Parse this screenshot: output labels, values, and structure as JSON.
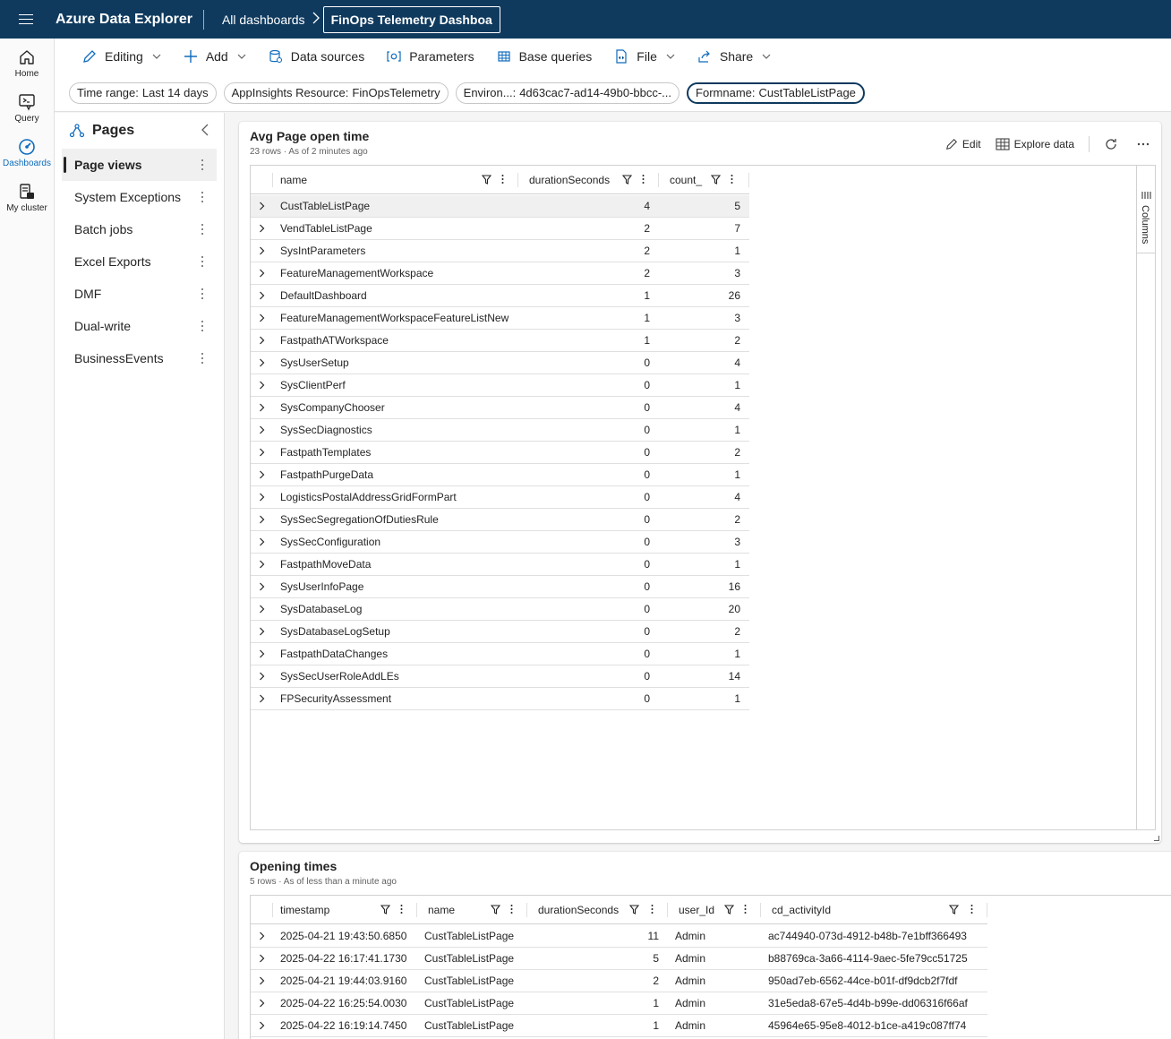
{
  "topbar": {
    "app_title": "Azure Data Explorer",
    "breadcrumb_root": "All dashboards",
    "breadcrumb_current": "FinOps Telemetry Dashboa"
  },
  "rail": {
    "home": "Home",
    "query": "Query",
    "dashboards": "Dashboards",
    "my_cluster": "My cluster"
  },
  "toolbar": {
    "editing": "Editing",
    "add": "Add",
    "data_sources": "Data sources",
    "parameters": "Parameters",
    "base_queries": "Base queries",
    "file": "File",
    "share": "Share"
  },
  "filters": [
    {
      "key": "Time range:",
      "value": "Last 14 days"
    },
    {
      "key": "AppInsights Resource:",
      "value": "FinOpsTelemetry"
    },
    {
      "key": "Environ...:",
      "value": "4d63cac7-ad14-49b0-bbcc-..."
    },
    {
      "key": "Formname:",
      "value": "CustTableListPage"
    }
  ],
  "pages": {
    "title": "Pages",
    "items": [
      "Page views",
      "System Exceptions",
      "Batch jobs",
      "Excel Exports",
      "DMF",
      "Dual-write",
      "BusinessEvents"
    ]
  },
  "tile1": {
    "title": "Avg Page open time",
    "subtitle": "23 rows · As of 2 minutes ago",
    "edit": "Edit",
    "explore": "Explore data",
    "columns_label": "Columns",
    "headers": [
      "name",
      "durationSeconds",
      "count_"
    ],
    "rows": [
      [
        "CustTableListPage",
        "4",
        "5"
      ],
      [
        "VendTableListPage",
        "2",
        "7"
      ],
      [
        "SysIntParameters",
        "2",
        "1"
      ],
      [
        "FeatureManagementWorkspace",
        "2",
        "3"
      ],
      [
        "DefaultDashboard",
        "1",
        "26"
      ],
      [
        "FeatureManagementWorkspaceFeatureListNew",
        "1",
        "3"
      ],
      [
        "FastpathATWorkspace",
        "1",
        "2"
      ],
      [
        "SysUserSetup",
        "0",
        "4"
      ],
      [
        "SysClientPerf",
        "0",
        "1"
      ],
      [
        "SysCompanyChooser",
        "0",
        "4"
      ],
      [
        "SysSecDiagnostics",
        "0",
        "1"
      ],
      [
        "FastpathTemplates",
        "0",
        "2"
      ],
      [
        "FastpathPurgeData",
        "0",
        "1"
      ],
      [
        "LogisticsPostalAddressGridFormPart",
        "0",
        "4"
      ],
      [
        "SysSecSegregationOfDutiesRule",
        "0",
        "2"
      ],
      [
        "SysSecConfiguration",
        "0",
        "3"
      ],
      [
        "FastpathMoveData",
        "0",
        "1"
      ],
      [
        "SysUserInfoPage",
        "0",
        "16"
      ],
      [
        "SysDatabaseLog",
        "0",
        "20"
      ],
      [
        "SysDatabaseLogSetup",
        "0",
        "2"
      ],
      [
        "FastpathDataChanges",
        "0",
        "1"
      ],
      [
        "SysSecUserRoleAddLEs",
        "0",
        "14"
      ],
      [
        "FPSecurityAssessment",
        "0",
        "1"
      ]
    ]
  },
  "tile2": {
    "title": "Opening times",
    "subtitle": "5 rows · As of less than a minute ago",
    "headers": [
      "timestamp",
      "name",
      "durationSeconds",
      "user_Id",
      "cd_activityId"
    ],
    "rows": [
      [
        "2025-04-21 19:43:50.6850",
        "CustTableListPage",
        "11",
        "Admin",
        "ac744940-073d-4912-b48b-7e1bff366493"
      ],
      [
        "2025-04-22 16:17:41.1730",
        "CustTableListPage",
        "5",
        "Admin",
        "b88769ca-3a66-4114-9aec-5fe79cc51725"
      ],
      [
        "2025-04-21 19:44:03.9160",
        "CustTableListPage",
        "2",
        "Admin",
        "950ad7eb-6562-44ce-b01f-df9dcb2f7fdf"
      ],
      [
        "2025-04-22 16:25:54.0030",
        "CustTableListPage",
        "1",
        "Admin",
        "31e5eda8-67e5-4d4b-b99e-dd06316f66af"
      ],
      [
        "2025-04-22 16:19:14.7450",
        "CustTableListPage",
        "1",
        "Admin",
        "45964e65-95e8-4012-b1ce-a419c087ff74"
      ]
    ]
  },
  "colors": {
    "topbar": "#0f3a5e",
    "accent": "#0f6cbd",
    "row_highlight": "#f0f0f0"
  }
}
